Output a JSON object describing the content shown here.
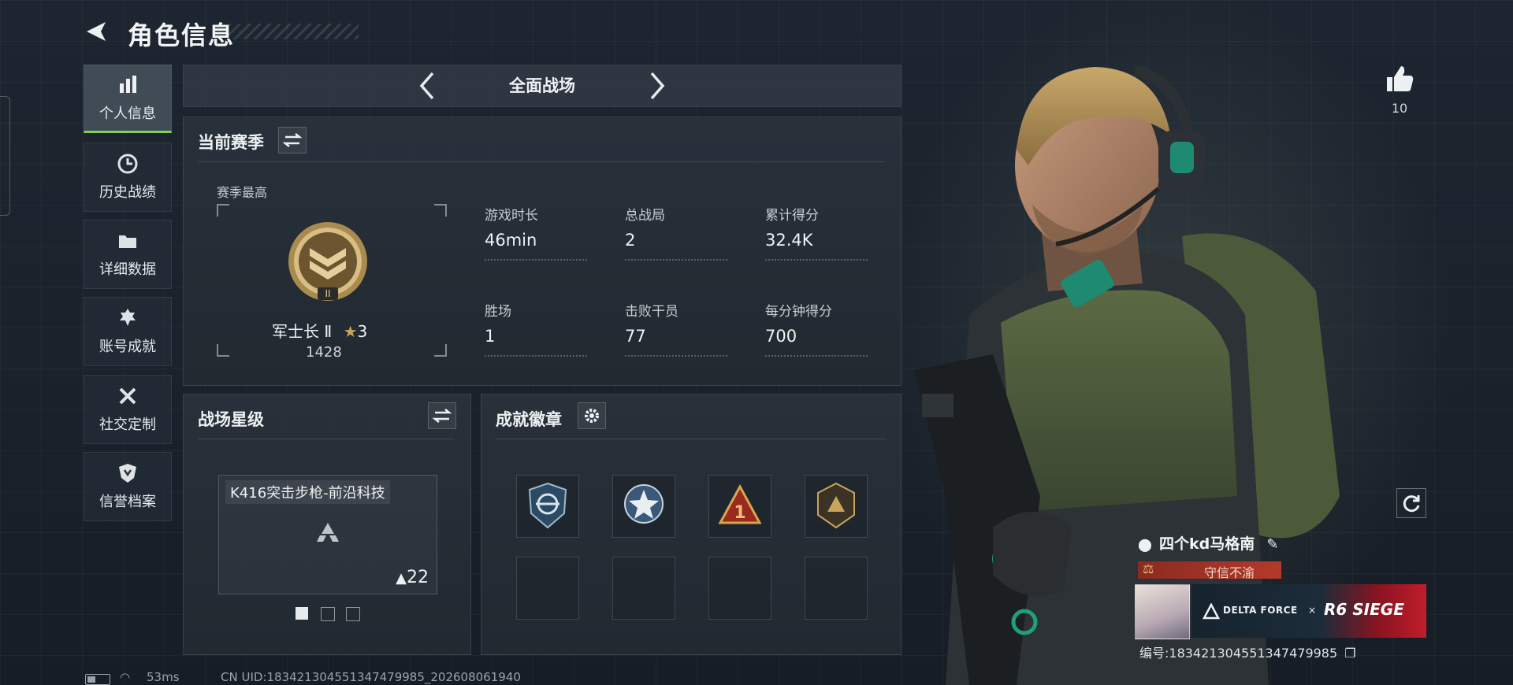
{
  "header": {
    "title": "角色信息"
  },
  "sidebar": {
    "items": [
      {
        "label": "个人信息",
        "icon": "bar-chart-icon",
        "active": true
      },
      {
        "label": "历史战绩",
        "icon": "clock-icon",
        "active": false
      },
      {
        "label": "详细数据",
        "icon": "folder-icon",
        "active": false
      },
      {
        "label": "账号成就",
        "icon": "achievement-icon",
        "active": false
      },
      {
        "label": "社交定制",
        "icon": "wrench-icon",
        "active": false
      },
      {
        "label": "信誉档案",
        "icon": "shield-icon",
        "active": false
      }
    ]
  },
  "mode": {
    "name": "全面战场"
  },
  "season": {
    "title": "当前赛季",
    "best_label": "赛季最高",
    "rank_name": "军士长 Ⅱ",
    "rank_stars": "3",
    "rank_points": "1428",
    "rank_roman": "II",
    "stats": [
      {
        "label": "游戏时长",
        "value": "46min"
      },
      {
        "label": "总战局",
        "value": "2"
      },
      {
        "label": "累计得分",
        "value": "32.4K"
      },
      {
        "label": "胜场",
        "value": "1"
      },
      {
        "label": "击败干员",
        "value": "77"
      },
      {
        "label": "每分钟得分",
        "value": "700"
      }
    ]
  },
  "battlefield_star": {
    "title": "战场星级",
    "weapon": "K416突击步枪-前沿科技",
    "stars": "22",
    "pages": 3,
    "current_page": 1
  },
  "achievements": {
    "title": "成就徽章"
  },
  "likes": {
    "count": "10"
  },
  "player": {
    "name": "四个kd马格南",
    "motto": "守信不渝",
    "banner_brand": "DELTA FORCE",
    "banner_x": "×",
    "banner_collab": "R6 SIEGE",
    "id_text": "编号:1834213045513474799​85"
  },
  "status_bar": {
    "ping": "53ms",
    "uid": "CN UID:183421304551347479985_202608061940"
  },
  "colors": {
    "accent_green": "#7fd05a",
    "motto_red": "#b33a2b",
    "gold": "#c9a45a"
  }
}
